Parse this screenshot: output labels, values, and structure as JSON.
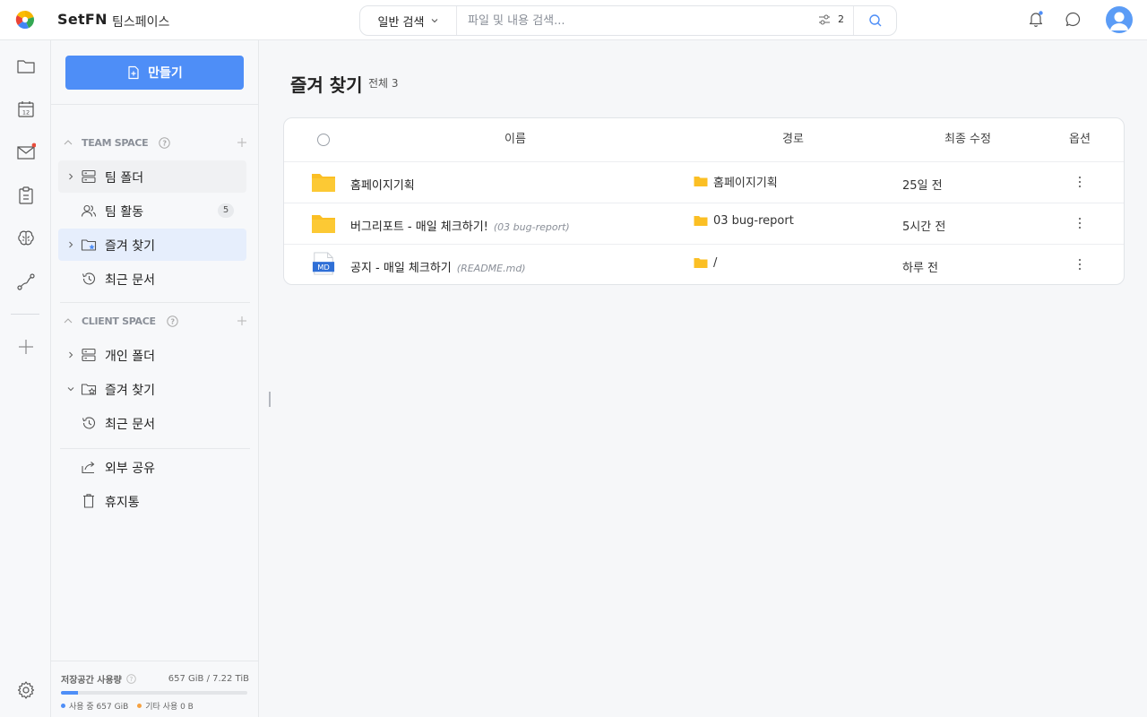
{
  "header": {
    "brand": "SetFN",
    "workspace": "팀스페이스",
    "search_mode": "일반 검색",
    "search_placeholder": "파일 및 내용 검색...",
    "filter_count": "2"
  },
  "sidebar": {
    "create_label": "만들기",
    "team_space": {
      "title": "TEAM SPACE",
      "items": [
        {
          "label": "팀 폴더"
        },
        {
          "label": "팀 활동",
          "badge": "5"
        },
        {
          "label": "즐겨 찾기"
        },
        {
          "label": "최근 문서"
        }
      ]
    },
    "client_space": {
      "title": "CLIENT SPACE",
      "items": [
        {
          "label": "개인 폴더"
        },
        {
          "label": "즐겨 찾기"
        },
        {
          "label": "최근 문서"
        }
      ]
    },
    "extra": [
      {
        "label": "외부 공유"
      },
      {
        "label": "휴지통"
      }
    ],
    "storage": {
      "label": "저장공간 사용량",
      "value": "657 GiB / 7.22 TiB",
      "used_fraction": 0.089,
      "used_label": "사용 중 657 GiB",
      "other_label": "기타 사용 0 B"
    }
  },
  "main": {
    "title": "즐겨 찾기",
    "count": "전체 3",
    "columns": {
      "name": "이름",
      "path": "경로",
      "modified": "최종 수정",
      "options": "옵션"
    },
    "rows": [
      {
        "icon": "folder-icon",
        "name": "홈페이지기획",
        "sub": "",
        "path": "홈페이지기획",
        "modified": "25일 전"
      },
      {
        "icon": "folder-icon",
        "name": "버그리포트 - 매일 체크하기!",
        "sub": "(03 bug-report)",
        "path": "03 bug-report",
        "modified": "5시간 전"
      },
      {
        "icon": "md-file-icon",
        "name": "공지 - 매일 체크하기",
        "sub": "(README.md)",
        "path": "/",
        "modified": "하루 전"
      }
    ]
  },
  "colors": {
    "accent": "#4e8ef7",
    "folder": "#fbbf24",
    "notify_dot": "#e74c3c"
  }
}
